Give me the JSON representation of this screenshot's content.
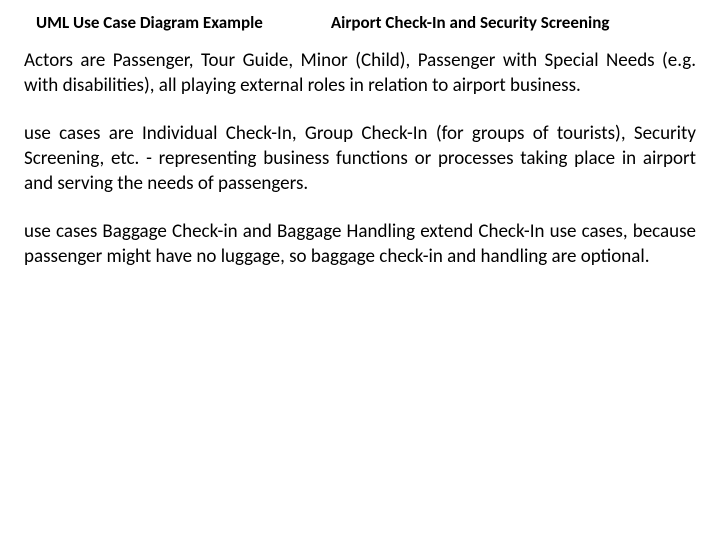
{
  "header": {
    "left": "UML Use Case Diagram Example",
    "right": "Airport Check-In and Security Screening"
  },
  "body": {
    "para1": "Actors are Passenger, Tour Guide, Minor (Child), Passenger with Special Needs (e.g. with disabilities), all playing external roles in relation to airport business.",
    "para2": "use cases are Individual Check-In, Group Check-In (for groups of tourists), Security Screening, etc. - representing business functions or processes taking place in airport and serving the needs of passengers.",
    "para3": "use cases Baggage Check-in and Baggage Handling extend Check-In use cases, because passenger might have no luggage, so baggage check-in and handling are optional."
  }
}
